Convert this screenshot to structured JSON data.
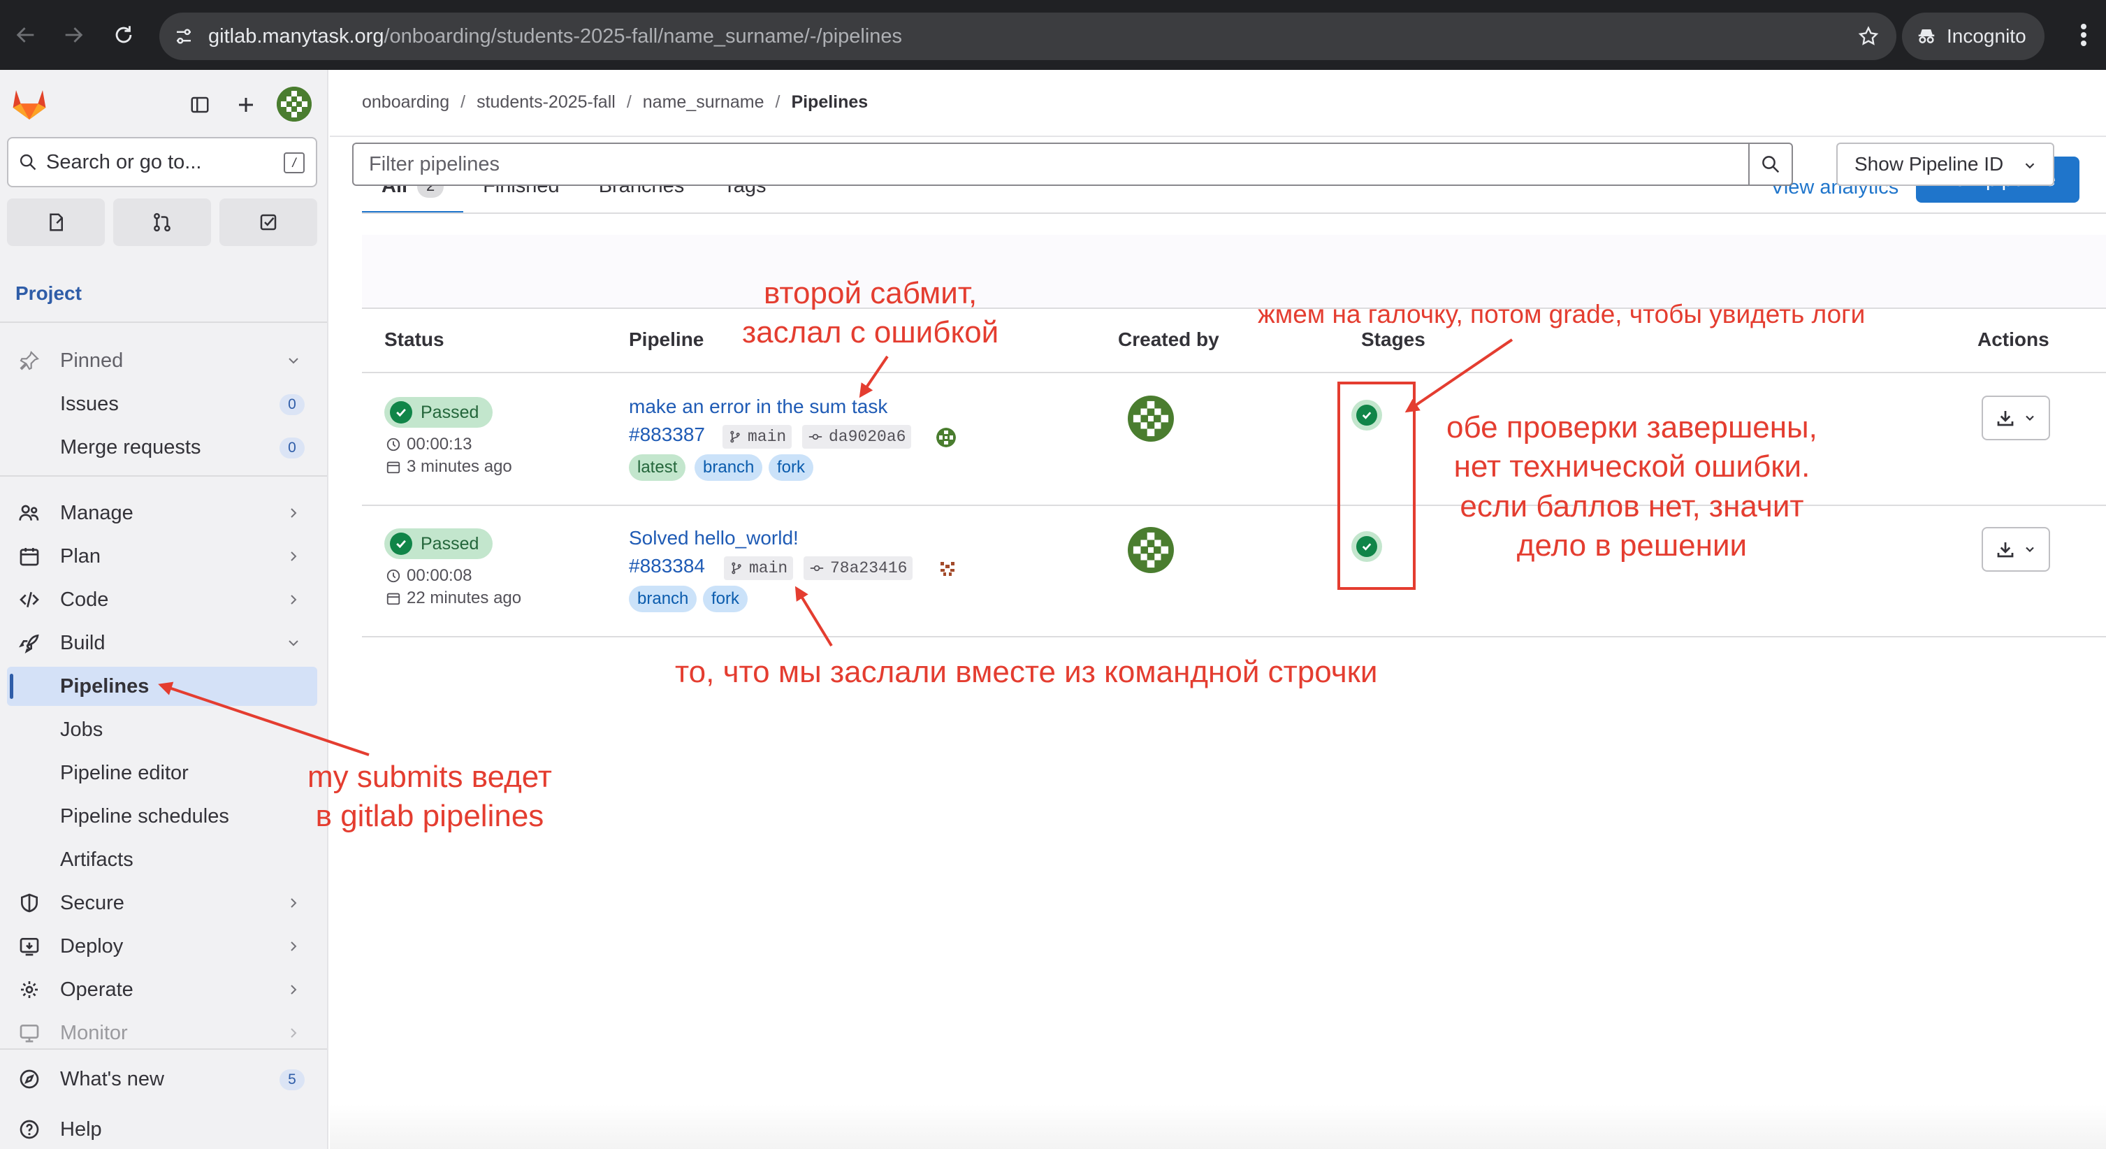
{
  "browser": {
    "url_host": "gitlab.manytask.org",
    "url_path": "/onboarding/students-2025-fall/name_surname/-/pipelines",
    "incognito_label": "Incognito"
  },
  "sidebar": {
    "search_placeholder": "Search or go to...",
    "search_shortcut": "/",
    "section_title": "Project",
    "pinned_label": "Pinned",
    "pinned_items": [
      {
        "label": "Issues",
        "count": "0"
      },
      {
        "label": "Merge requests",
        "count": "0"
      }
    ],
    "groups": [
      {
        "label": "Manage",
        "icon": "users-icon"
      },
      {
        "label": "Plan",
        "icon": "calendar-icon"
      },
      {
        "label": "Code",
        "icon": "code-icon"
      },
      {
        "label": "Build",
        "icon": "rocket-icon"
      }
    ],
    "build_items": [
      "Pipelines",
      "Jobs",
      "Pipeline editor",
      "Pipeline schedules",
      "Artifacts"
    ],
    "more_groups": [
      {
        "label": "Secure",
        "icon": "shield-icon"
      },
      {
        "label": "Deploy",
        "icon": "deploy-icon"
      },
      {
        "label": "Operate",
        "icon": "cloud-gear-icon"
      },
      {
        "label": "Monitor",
        "icon": "monitor-icon"
      }
    ],
    "whats_new_label": "What's new",
    "whats_new_count": "5",
    "help_label": "Help"
  },
  "breadcrumb": [
    "onboarding",
    "students-2025-fall",
    "name_surname",
    "Pipelines"
  ],
  "tabs": {
    "all_label": "All",
    "all_count": "2",
    "finished_label": "Finished",
    "branches_label": "Branches",
    "tags_label": "Tags"
  },
  "header_actions": {
    "view_analytics": "View analytics",
    "new_pipeline": "New pipeline"
  },
  "filter": {
    "placeholder": "Filter pipelines",
    "show_id_label": "Show Pipeline ID"
  },
  "columns": [
    "Status",
    "Pipeline",
    "Created by",
    "Stages",
    "Actions"
  ],
  "pipelines": [
    {
      "status": "Passed",
      "duration": "00:00:13",
      "finished": "3 minutes ago",
      "title": "make an error in the sum task",
      "id": "#883387",
      "branch": "main",
      "commit": "da9020a6",
      "tags": [
        "latest",
        "branch",
        "fork"
      ]
    },
    {
      "status": "Passed",
      "duration": "00:00:08",
      "finished": "22 minutes ago",
      "title": "Solved hello_world!",
      "id": "#883384",
      "branch": "main",
      "commit": "78a23416",
      "tags": [
        "branch",
        "fork"
      ]
    }
  ],
  "annotations": {
    "second_submit": [
      "второй сабмит,",
      "заслал с ошибкой"
    ],
    "click_check": "жмем на галочку, потом grade, чтобы увидеть логи",
    "both_checks": [
      "обе проверки завершены,",
      "нет технической ошибки.",
      "если баллов нет, значит",
      "дело в решении"
    ],
    "command_line": "то, что мы заслали вместе из командной строчки",
    "my_submits": [
      "my submits ведет",
      "в gitlab pipelines"
    ]
  },
  "colors": {
    "accent": "#1f75cb",
    "success": "#108548",
    "annotation": "#e43d30",
    "avatar": "#4a7d2f",
    "avatar_alt": "#a34a2a"
  }
}
